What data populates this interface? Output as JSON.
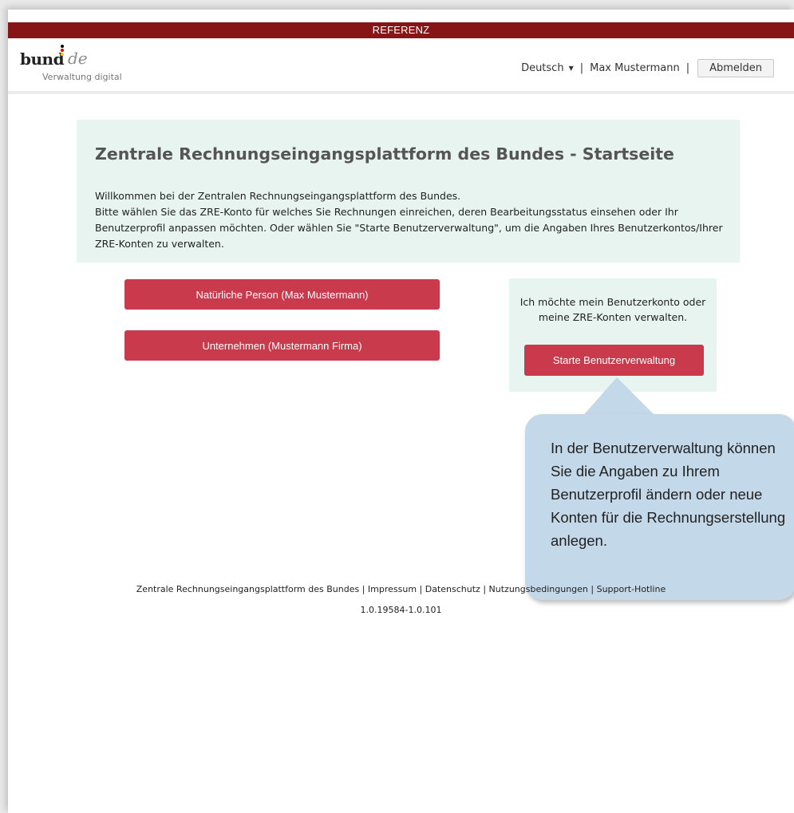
{
  "topbar": {
    "label": "REFERENZ"
  },
  "header": {
    "logo": {
      "main": "bund",
      "suffix": "de",
      "subtitle": "Verwaltung digital"
    },
    "language": "Deutsch",
    "separator": "|",
    "user_name": "Max Mustermann",
    "logout_label": "Abmelden"
  },
  "intro": {
    "title": "Zentrale Rechnungseingangsplattform des Bundes - Startseite",
    "line1": "Willkommen bei der Zentralen Rechnungseingangsplattform des Bundes.",
    "line2": "Bitte wählen Sie das ZRE-Konto für welches Sie Rechnungen einreichen, deren Bearbeitungsstatus einsehen oder Ihr Benutzerprofil anpassen möchten. Oder wählen Sie \"Starte Benutzerverwaltung\", um die Angaben Ihres Benutzerkontos/Ihrer ZRE-Konten zu verwalten."
  },
  "accounts": [
    {
      "label": "Natürliche Person (Max Mustermann)"
    },
    {
      "label": "Unternehmen (Mustermann Firma)"
    }
  ],
  "management": {
    "text": "Ich möchte mein Benutzerkonto oder meine ZRE-Konten verwalten.",
    "button_label": "Starte Benutzerverwaltung"
  },
  "callout": {
    "text": "In der Benutzerverwaltung können Sie die Angaben zu Ihrem Benutzerprofil ändern oder neue Konten für die Rechnungserstellung anlegen."
  },
  "footer": {
    "links": [
      "Zentrale Rechnungseingangsplattform des Bundes",
      "Impressum",
      "Datenschutz",
      "Nutzungsbedingungen",
      "Support-Hotline"
    ],
    "separator": "|",
    "version": "1.0.19584-1.0.101"
  },
  "colors": {
    "topbar": "#871515",
    "button_red": "#c83a4c",
    "panel_bg": "#e8f4f0",
    "callout_bg": "#c3d8e8",
    "flag_black": "#000000",
    "flag_red": "#dd0000",
    "flag_gold": "#ffcc00"
  },
  "icons": {
    "language_caret": "caret-down-icon"
  }
}
